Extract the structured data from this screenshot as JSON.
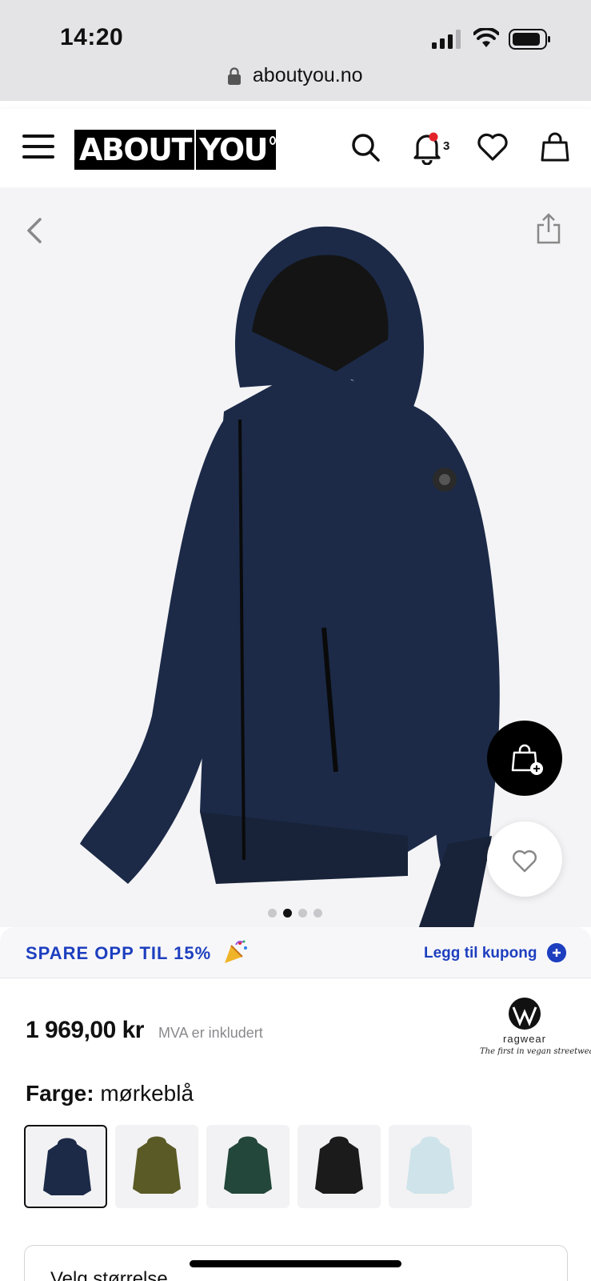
{
  "status_bar": {
    "time": "14:20"
  },
  "browser": {
    "url": "aboutyou.no"
  },
  "header": {
    "logo_left": "ABOUT",
    "logo_right": "YOU",
    "notification_count": "3",
    "notification_dot_color": "#e2232a"
  },
  "gallery": {
    "image_count": 4,
    "active_image_index": 1,
    "product_color": "#1c2a48"
  },
  "promo": {
    "text": "SPARE OPP TIL 15%",
    "coupon_label": "Legg til kupong",
    "accent_color": "#1d3fbf"
  },
  "product": {
    "price": "1 969,00 kr",
    "vat_note": "MVA er inkludert",
    "brand_name": "ragwear",
    "brand_tagline": "The first in vegan streetwear"
  },
  "color_selector": {
    "label": "Farge:",
    "value": "mørkeblå",
    "swatches": [
      {
        "name": "mørkeblå",
        "color": "#1c2a48",
        "selected": true
      },
      {
        "name": "oliven",
        "color": "#5a5a26",
        "selected": false
      },
      {
        "name": "mørkegrønn",
        "color": "#23473a",
        "selected": false
      },
      {
        "name": "svart",
        "color": "#1b1b1b",
        "selected": false
      },
      {
        "name": "lyseblå",
        "color": "#cfe3ea",
        "selected": false
      }
    ]
  },
  "size_selector": {
    "label": "Velg størrelse"
  }
}
